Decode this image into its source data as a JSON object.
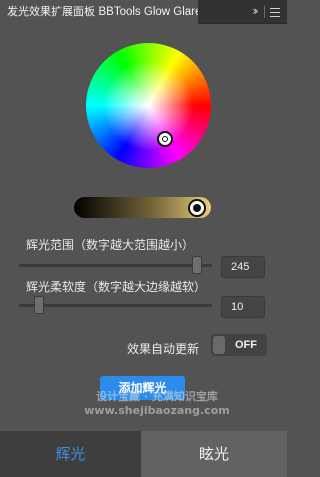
{
  "panel": {
    "title_cn": "发光效果扩展面板",
    "title_en": "BBTools Glow Glare"
  },
  "color_picker": {
    "brightness_color": "#e9cc78"
  },
  "glow_range": {
    "label": "辉光范围（数字越大范围越小）",
    "value": "245"
  },
  "glow_softness": {
    "label": "辉光柔软度（数字越大边缘越软）",
    "value": "10"
  },
  "auto_update": {
    "label": "效果自动更新",
    "state": "OFF"
  },
  "add_button": {
    "label": "添加辉光",
    "color": "#2d8ceb"
  },
  "watermark": {
    "line1": "设计宝藏 · 充满知识宝库",
    "line2": "www.shejibaozang.com"
  },
  "tabs": {
    "glow": "辉光",
    "glare": "眩光",
    "active_color": "#3c8fe6"
  }
}
